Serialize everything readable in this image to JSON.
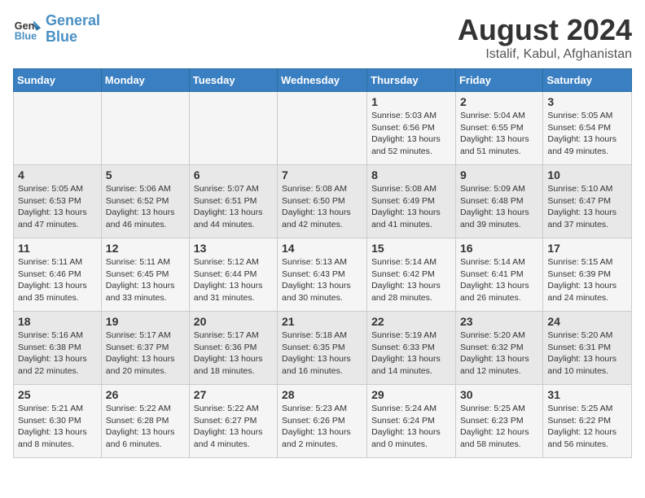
{
  "logo": {
    "text_general": "General",
    "text_blue": "Blue"
  },
  "title": "August 2024",
  "subtitle": "Istalif, Kabul, Afghanistan",
  "headers": [
    "Sunday",
    "Monday",
    "Tuesday",
    "Wednesday",
    "Thursday",
    "Friday",
    "Saturday"
  ],
  "weeks": [
    [
      {
        "day": "",
        "content": ""
      },
      {
        "day": "",
        "content": ""
      },
      {
        "day": "",
        "content": ""
      },
      {
        "day": "",
        "content": ""
      },
      {
        "day": "1",
        "content": "Sunrise: 5:03 AM\nSunset: 6:56 PM\nDaylight: 13 hours\nand 52 minutes."
      },
      {
        "day": "2",
        "content": "Sunrise: 5:04 AM\nSunset: 6:55 PM\nDaylight: 13 hours\nand 51 minutes."
      },
      {
        "day": "3",
        "content": "Sunrise: 5:05 AM\nSunset: 6:54 PM\nDaylight: 13 hours\nand 49 minutes."
      }
    ],
    [
      {
        "day": "4",
        "content": "Sunrise: 5:05 AM\nSunset: 6:53 PM\nDaylight: 13 hours\nand 47 minutes."
      },
      {
        "day": "5",
        "content": "Sunrise: 5:06 AM\nSunset: 6:52 PM\nDaylight: 13 hours\nand 46 minutes."
      },
      {
        "day": "6",
        "content": "Sunrise: 5:07 AM\nSunset: 6:51 PM\nDaylight: 13 hours\nand 44 minutes."
      },
      {
        "day": "7",
        "content": "Sunrise: 5:08 AM\nSunset: 6:50 PM\nDaylight: 13 hours\nand 42 minutes."
      },
      {
        "day": "8",
        "content": "Sunrise: 5:08 AM\nSunset: 6:49 PM\nDaylight: 13 hours\nand 41 minutes."
      },
      {
        "day": "9",
        "content": "Sunrise: 5:09 AM\nSunset: 6:48 PM\nDaylight: 13 hours\nand 39 minutes."
      },
      {
        "day": "10",
        "content": "Sunrise: 5:10 AM\nSunset: 6:47 PM\nDaylight: 13 hours\nand 37 minutes."
      }
    ],
    [
      {
        "day": "11",
        "content": "Sunrise: 5:11 AM\nSunset: 6:46 PM\nDaylight: 13 hours\nand 35 minutes."
      },
      {
        "day": "12",
        "content": "Sunrise: 5:11 AM\nSunset: 6:45 PM\nDaylight: 13 hours\nand 33 minutes."
      },
      {
        "day": "13",
        "content": "Sunrise: 5:12 AM\nSunset: 6:44 PM\nDaylight: 13 hours\nand 31 minutes."
      },
      {
        "day": "14",
        "content": "Sunrise: 5:13 AM\nSunset: 6:43 PM\nDaylight: 13 hours\nand 30 minutes."
      },
      {
        "day": "15",
        "content": "Sunrise: 5:14 AM\nSunset: 6:42 PM\nDaylight: 13 hours\nand 28 minutes."
      },
      {
        "day": "16",
        "content": "Sunrise: 5:14 AM\nSunset: 6:41 PM\nDaylight: 13 hours\nand 26 minutes."
      },
      {
        "day": "17",
        "content": "Sunrise: 5:15 AM\nSunset: 6:39 PM\nDaylight: 13 hours\nand 24 minutes."
      }
    ],
    [
      {
        "day": "18",
        "content": "Sunrise: 5:16 AM\nSunset: 6:38 PM\nDaylight: 13 hours\nand 22 minutes."
      },
      {
        "day": "19",
        "content": "Sunrise: 5:17 AM\nSunset: 6:37 PM\nDaylight: 13 hours\nand 20 minutes."
      },
      {
        "day": "20",
        "content": "Sunrise: 5:17 AM\nSunset: 6:36 PM\nDaylight: 13 hours\nand 18 minutes."
      },
      {
        "day": "21",
        "content": "Sunrise: 5:18 AM\nSunset: 6:35 PM\nDaylight: 13 hours\nand 16 minutes."
      },
      {
        "day": "22",
        "content": "Sunrise: 5:19 AM\nSunset: 6:33 PM\nDaylight: 13 hours\nand 14 minutes."
      },
      {
        "day": "23",
        "content": "Sunrise: 5:20 AM\nSunset: 6:32 PM\nDaylight: 13 hours\nand 12 minutes."
      },
      {
        "day": "24",
        "content": "Sunrise: 5:20 AM\nSunset: 6:31 PM\nDaylight: 13 hours\nand 10 minutes."
      }
    ],
    [
      {
        "day": "25",
        "content": "Sunrise: 5:21 AM\nSunset: 6:30 PM\nDaylight: 13 hours\nand 8 minutes."
      },
      {
        "day": "26",
        "content": "Sunrise: 5:22 AM\nSunset: 6:28 PM\nDaylight: 13 hours\nand 6 minutes."
      },
      {
        "day": "27",
        "content": "Sunrise: 5:22 AM\nSunset: 6:27 PM\nDaylight: 13 hours\nand 4 minutes."
      },
      {
        "day": "28",
        "content": "Sunrise: 5:23 AM\nSunset: 6:26 PM\nDaylight: 13 hours\nand 2 minutes."
      },
      {
        "day": "29",
        "content": "Sunrise: 5:24 AM\nSunset: 6:24 PM\nDaylight: 13 hours\nand 0 minutes."
      },
      {
        "day": "30",
        "content": "Sunrise: 5:25 AM\nSunset: 6:23 PM\nDaylight: 12 hours\nand 58 minutes."
      },
      {
        "day": "31",
        "content": "Sunrise: 5:25 AM\nSunset: 6:22 PM\nDaylight: 12 hours\nand 56 minutes."
      }
    ]
  ]
}
